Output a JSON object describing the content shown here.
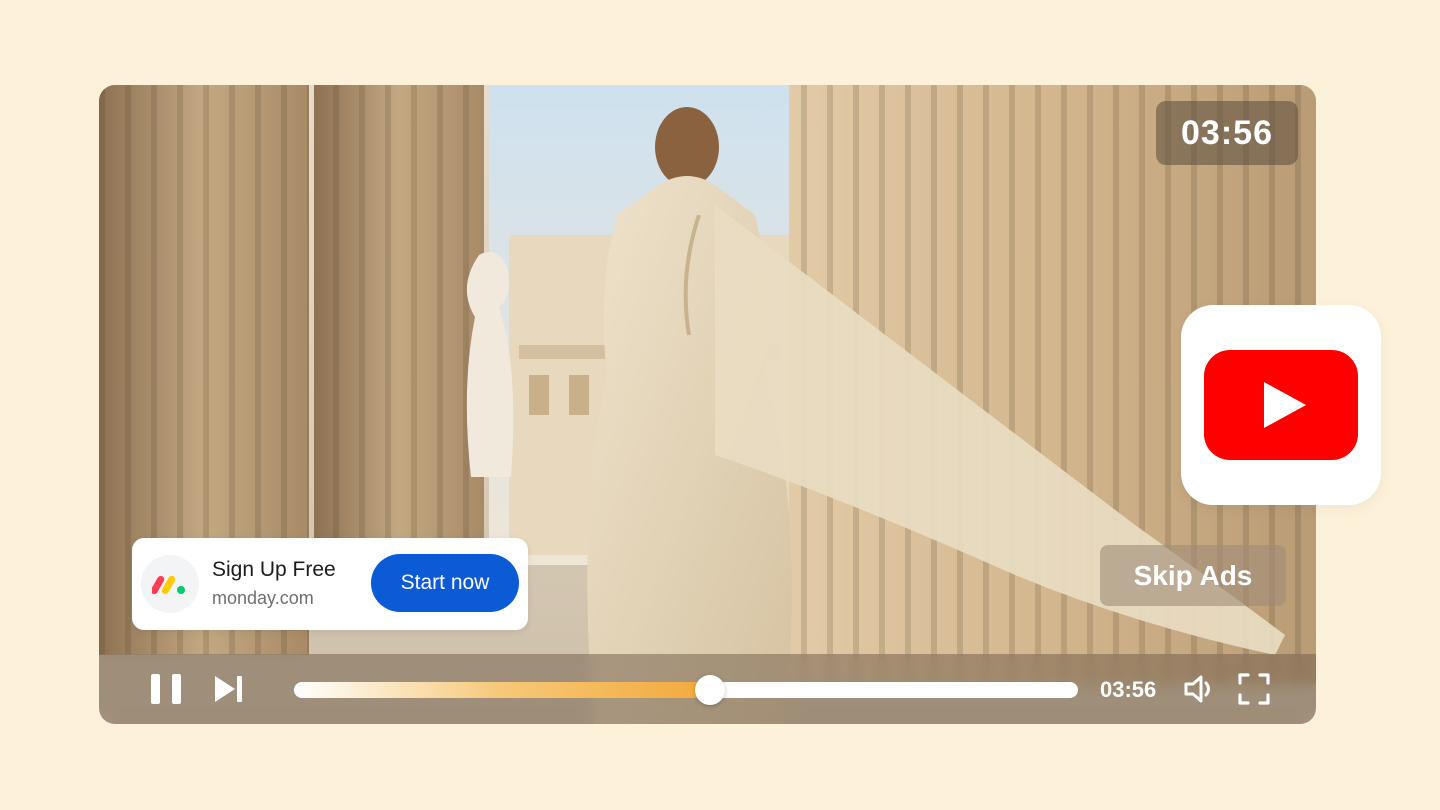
{
  "player": {
    "duration_badge": "03:56",
    "current_time": "03:56",
    "progress": 0.53,
    "skip_label": "Skip Ads"
  },
  "ad": {
    "title": "Sign Up Free",
    "domain": "monday.com",
    "cta_label": "Start now",
    "logo_colors": [
      "#ff3d57",
      "#ffcb00",
      "#00ca72"
    ]
  },
  "icons": {
    "pause": "pause-icon",
    "next": "skip-next-icon",
    "volume": "volume-icon",
    "fullscreen": "fullscreen-icon",
    "brand": "youtube-logo"
  },
  "colors": {
    "background": "#fdf2d9",
    "accent_cta": "#0b5ad6",
    "youtube_red": "#ff0000",
    "progress_orange": "#f3a93b"
  }
}
